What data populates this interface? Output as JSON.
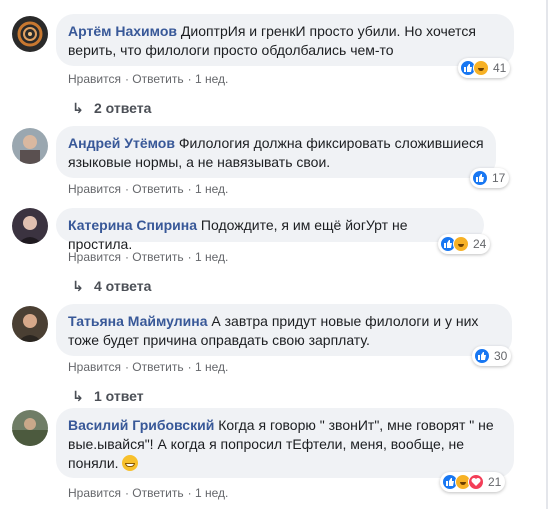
{
  "colors": {
    "author": "#385898",
    "bubble_bg": "#f0f2f5",
    "meta": "#65676b",
    "like": "#1877f2",
    "haha": "#f7b125",
    "love": "#f33e58"
  },
  "comments": [
    {
      "author": "Артём Нахимов",
      "text_line1": "ДиоптрИя и гренкИ просто убили. Но хочется",
      "text_line2": "верить, что филологи просто обдолбались чем-то",
      "actions": {
        "like": "Нравится",
        "reply": "Ответить",
        "time": "1 нед."
      },
      "reactions": [
        "like-icon",
        "haha-icon"
      ],
      "reaction_count": "41",
      "replies_label": "2 ответа"
    },
    {
      "author": "Андрей Утёмов",
      "text_line1": "Филология должна фиксировать сложившиеся",
      "text_line2": "языковые нормы, а не навязывать свои.",
      "actions": {
        "like": "Нравится",
        "reply": "Ответить",
        "time": "1 нед."
      },
      "reactions": [
        "like-icon"
      ],
      "reaction_count": "17"
    },
    {
      "author": "Катерина Спирина",
      "text_line1": "Подождите, я им ещё йогУрт не простила.",
      "actions": {
        "like": "Нравится",
        "reply": "Ответить",
        "time": "1 нед."
      },
      "reactions": [
        "like-icon",
        "haha-icon"
      ],
      "reaction_count": "24",
      "replies_label": "4 ответа"
    },
    {
      "author": "Татьяна Маймулина",
      "text_line1": "А завтра придут новые филологи и у них",
      "text_line2": "тоже будет причина оправдать свою зарплату.",
      "actions": {
        "like": "Нравится",
        "reply": "Ответить",
        "time": "1 нед."
      },
      "reactions": [
        "like-icon"
      ],
      "reaction_count": "30",
      "replies_label": "1 ответ"
    },
    {
      "author": "Василий Грибовский",
      "text_line1": "Когда я говорю \" звонИт\", мне говорят \" не",
      "text_line2": "вые.ывайся\"! А когда я попросил тЕфтели, меня, вообще, не",
      "text_line3": "поняли.",
      "actions": {
        "like": "Нравится",
        "reply": "Ответить",
        "time": "1 нед."
      },
      "reactions": [
        "like-icon",
        "haha-icon",
        "love-icon"
      ],
      "reaction_count": "21"
    }
  ]
}
